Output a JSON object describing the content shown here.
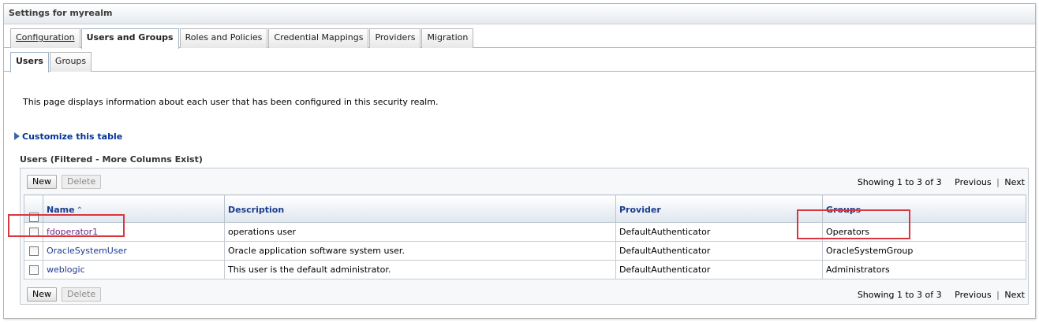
{
  "panel": {
    "title": "Settings for myrealm"
  },
  "tabs": [
    {
      "label": "Configuration"
    },
    {
      "label": "Users and Groups"
    },
    {
      "label": "Roles and Policies"
    },
    {
      "label": "Credential Mappings"
    },
    {
      "label": "Providers"
    },
    {
      "label": "Migration"
    }
  ],
  "subtabs": [
    {
      "label": "Users"
    },
    {
      "label": "Groups"
    }
  ],
  "intro": "This page displays information about each user that has been configured in this security realm.",
  "customize_label": "Customize this table",
  "table": {
    "title": "Users (Filtered - More Columns Exist)",
    "new_label": "New",
    "delete_label": "Delete",
    "paging": {
      "showing": "Showing 1 to 3 of 3",
      "previous": "Previous",
      "next": "Next"
    },
    "columns": [
      "Name",
      "Description",
      "Provider",
      "Groups"
    ],
    "rows": [
      {
        "name": "fdoperator1",
        "description": "operations user",
        "provider": "DefaultAuthenticator",
        "groups": "Operators"
      },
      {
        "name": "OracleSystemUser",
        "description": "Oracle application software system user.",
        "provider": "DefaultAuthenticator",
        "groups": "OracleSystemGroup"
      },
      {
        "name": "weblogic",
        "description": "This user is the default administrator.",
        "provider": "DefaultAuthenticator",
        "groups": "Administrators"
      }
    ]
  },
  "colors": {
    "link": "#1e3a8f",
    "highlight": "#d9363e"
  },
  "icons": {
    "sort": "sort-ascending-icon",
    "customize": "expand-triangle-icon"
  }
}
